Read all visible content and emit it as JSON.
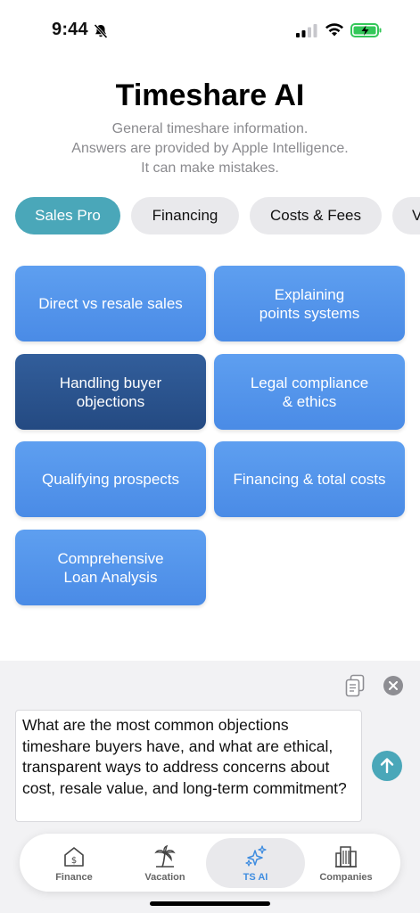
{
  "status_bar": {
    "time": "9:44"
  },
  "header": {
    "title": "Timeshare AI",
    "subtitle_lines": [
      "General timeshare information.",
      "Answers are provided by Apple Intelligence.",
      "It can make mistakes."
    ]
  },
  "tabs": [
    {
      "label": "Sales Pro",
      "active": true
    },
    {
      "label": "Financing",
      "active": false
    },
    {
      "label": "Costs & Fees",
      "active": false
    },
    {
      "label": "V",
      "active": false
    }
  ],
  "topics": [
    {
      "lines": [
        "Direct vs resale sales"
      ],
      "selected": false
    },
    {
      "lines": [
        "Explaining",
        "points systems"
      ],
      "selected": false
    },
    {
      "lines": [
        "Handling buyer",
        "objections"
      ],
      "selected": true
    },
    {
      "lines": [
        "Legal compliance",
        "& ethics"
      ],
      "selected": false
    },
    {
      "lines": [
        "Qualifying prospects"
      ],
      "selected": false
    },
    {
      "lines": [
        "Financing & total costs"
      ],
      "selected": false
    },
    {
      "lines": [
        "Comprehensive",
        "Loan Analysis"
      ],
      "selected": false
    }
  ],
  "composer": {
    "prompt_text": "What are the most common objections timeshare buyers have, and what are ethical, transparent ways to address concerns about cost, resale value, and long-term commitment?"
  },
  "tab_bar": [
    {
      "label": "Finance",
      "icon": "house-dollar-icon",
      "active": false
    },
    {
      "label": "Vacation",
      "icon": "palm-tree-icon",
      "active": false
    },
    {
      "label": "TS AI",
      "icon": "sparkles-icon",
      "active": true
    },
    {
      "label": "Companies",
      "icon": "buildings-icon",
      "active": false
    }
  ],
  "colors": {
    "accent_teal": "#4aa7b9",
    "card_blue": "#5a9bef",
    "card_selected": "#2c5591",
    "tab_active_blue": "#3f8de0"
  }
}
